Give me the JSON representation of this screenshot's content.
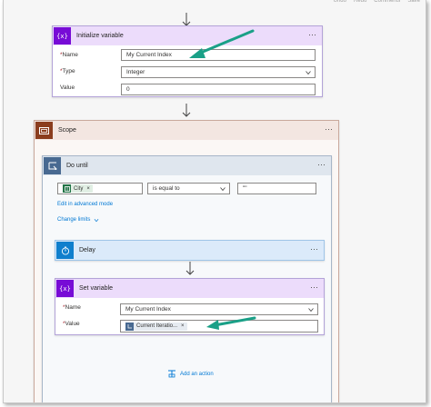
{
  "toolbar": {
    "undo": "Undo",
    "redo": "Redo",
    "comments": "Comments",
    "save": "Save"
  },
  "init_variable": {
    "title": "Initialize variable",
    "icon_glyph": "{x}",
    "name_label": "Name",
    "name_value": "My Current Index",
    "type_label": "Type",
    "type_value": "Integer",
    "value_label": "Value",
    "value_value": "0",
    "accent": "#770bd6"
  },
  "scope": {
    "title": "Scope",
    "accent": "#8b3d1e"
  },
  "do_until": {
    "title": "Do until",
    "accent": "#486991",
    "condition_token": "City",
    "operator": "is equal to",
    "right_value": "\"\"",
    "advanced_link": "Edit in advanced mode",
    "change_limits": "Change limits"
  },
  "delay": {
    "title": "Delay",
    "accent": "#0f7fcd"
  },
  "set_variable": {
    "title": "Set variable",
    "icon_glyph": "{x}",
    "name_label": "Name",
    "name_value": "My Current Index",
    "value_label": "Value",
    "value_token": "Current Iteratio..."
  },
  "add_action": "Add an action",
  "icons": {
    "more": "ellipsis-icon",
    "arrow": "arrow-down-icon",
    "annotation": "green-arrow-icon"
  },
  "colors": {
    "annotation_green": "#1aa087",
    "link_blue": "#0078d4"
  }
}
